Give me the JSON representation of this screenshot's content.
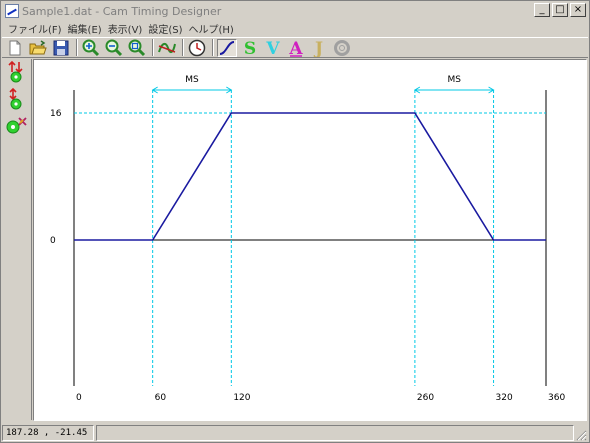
{
  "window": {
    "title": "Sample1.dat - Cam Timing Designer",
    "minimize_glyph": "_",
    "maximize_glyph": "□",
    "close_glyph": "×"
  },
  "menu": [
    {
      "label": "ファイル(F)"
    },
    {
      "label": "編集(E)"
    },
    {
      "label": "表示(V)"
    },
    {
      "label": "設定(S)"
    },
    {
      "label": "ヘルプ(H)"
    }
  ],
  "toolbar": {
    "icons": [
      "new-file-icon",
      "open-folder-icon",
      "save-icon",
      "zoom-in-icon",
      "zoom-out-icon",
      "zoom-fit-icon",
      "graph-icon",
      "clock-icon",
      "displacement-icon",
      "velocity-s-icon",
      "velocity-v-icon",
      "acceleration-a-icon",
      "jerk-j-icon",
      "settings-ring-icon"
    ],
    "letters": {
      "s": "S",
      "v": "V",
      "a": "A",
      "j": "J"
    }
  },
  "sidebar": {
    "icons": [
      "move-up-down-icon",
      "move-up-down-alt-icon",
      "edit-point-icon"
    ]
  },
  "chart_data": {
    "type": "line",
    "series": [
      {
        "values": [
          [
            0,
            0
          ],
          [
            60,
            0
          ],
          [
            120,
            16
          ],
          [
            260,
            16
          ],
          [
            320,
            0
          ],
          [
            360,
            0
          ]
        ]
      }
    ],
    "x_ticks": [
      "0",
      "60",
      "120",
      "260",
      "320",
      "360"
    ],
    "y_ticks": [
      "16",
      "0"
    ],
    "xlim": [
      0,
      360
    ],
    "ylim": [
      0,
      16
    ],
    "spans": [
      {
        "label": "MS",
        "from": 60,
        "to": 120
      },
      {
        "label": "MS",
        "from": 260,
        "to": 320
      }
    ],
    "colors": {
      "curve": "#1a1aa0",
      "guide": "#00c8e6",
      "axis": "#000000"
    }
  },
  "status": {
    "coords": "187.28 , -21.45"
  }
}
